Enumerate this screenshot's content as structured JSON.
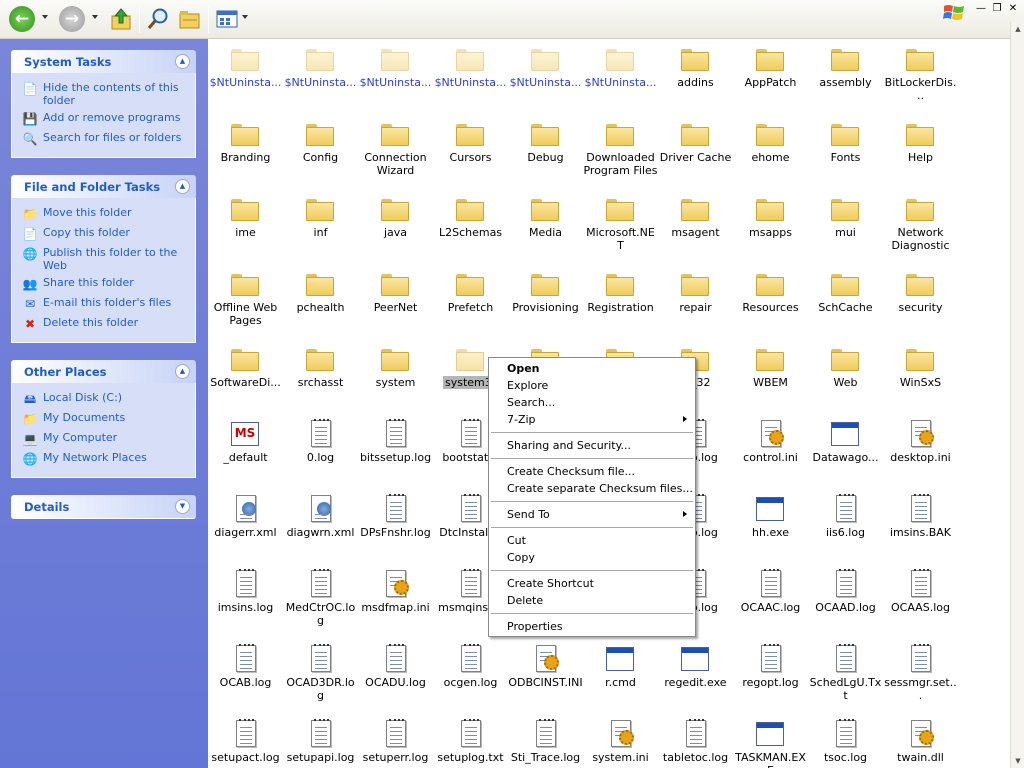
{
  "toolbar": {
    "back": "back-arrow-icon",
    "forward": "forward-arrow-icon",
    "up": "up-folder-icon",
    "search": "search-icon",
    "folders": "folders-icon",
    "views": "views-icon"
  },
  "left_pane": {
    "system_tasks": {
      "title": "System Tasks",
      "items": [
        {
          "label": "Hide the contents of this folder",
          "icon": "hide-icon"
        },
        {
          "label": "Add or remove programs",
          "icon": "add-remove-icon"
        },
        {
          "label": "Search for files or folders",
          "icon": "search-icon"
        }
      ]
    },
    "file_tasks": {
      "title": "File and Folder Tasks",
      "items": [
        {
          "label": "Move this folder",
          "icon": "move-icon"
        },
        {
          "label": "Copy this folder",
          "icon": "copy-icon"
        },
        {
          "label": "Publish this folder to the Web",
          "icon": "publish-icon"
        },
        {
          "label": "Share this folder",
          "icon": "share-icon"
        },
        {
          "label": "E-mail this folder's files",
          "icon": "email-icon"
        },
        {
          "label": "Delete this folder",
          "icon": "delete-icon"
        }
      ]
    },
    "other_places": {
      "title": "Other Places",
      "items": [
        {
          "label": "Local Disk (C:)",
          "icon": "drive-icon"
        },
        {
          "label": "My Documents",
          "icon": "my-documents-icon"
        },
        {
          "label": "My Computer",
          "icon": "my-computer-icon"
        },
        {
          "label": "My Network Places",
          "icon": "network-icon"
        }
      ]
    },
    "details": {
      "title": "Details"
    }
  },
  "files": [
    {
      "name": "$NtUninsta...",
      "type": "folder",
      "hidden": true
    },
    {
      "name": "$NtUninsta...",
      "type": "folder",
      "hidden": true
    },
    {
      "name": "$NtUninsta...",
      "type": "folder",
      "hidden": true
    },
    {
      "name": "$NtUninsta...",
      "type": "folder",
      "hidden": true
    },
    {
      "name": "$NtUninsta...",
      "type": "folder",
      "hidden": true
    },
    {
      "name": "$NtUninsta...",
      "type": "folder",
      "hidden": true
    },
    {
      "name": "addins",
      "type": "folder"
    },
    {
      "name": "AppPatch",
      "type": "folder"
    },
    {
      "name": "assembly",
      "type": "folder"
    },
    {
      "name": "BitLockerDis...",
      "type": "folder"
    },
    {
      "name": "Branding",
      "type": "folder"
    },
    {
      "name": "Config",
      "type": "folder"
    },
    {
      "name": "Connection Wizard",
      "type": "folder"
    },
    {
      "name": "Cursors",
      "type": "folder"
    },
    {
      "name": "Debug",
      "type": "folder"
    },
    {
      "name": "Downloaded Program Files",
      "type": "folder"
    },
    {
      "name": "Driver Cache",
      "type": "folder"
    },
    {
      "name": "ehome",
      "type": "folder"
    },
    {
      "name": "Fonts",
      "type": "folder"
    },
    {
      "name": "Help",
      "type": "folder"
    },
    {
      "name": "ime",
      "type": "folder"
    },
    {
      "name": "inf",
      "type": "folder"
    },
    {
      "name": "java",
      "type": "folder"
    },
    {
      "name": "L2Schemas",
      "type": "folder"
    },
    {
      "name": "Media",
      "type": "folder"
    },
    {
      "name": "Microsoft.NET",
      "type": "folder"
    },
    {
      "name": "msagent",
      "type": "folder"
    },
    {
      "name": "msapps",
      "type": "folder"
    },
    {
      "name": "mui",
      "type": "folder"
    },
    {
      "name": "Network Diagnostic",
      "type": "folder"
    },
    {
      "name": "Offline Web Pages",
      "type": "folder"
    },
    {
      "name": "pchealth",
      "type": "folder"
    },
    {
      "name": "PeerNet",
      "type": "folder"
    },
    {
      "name": "Prefetch",
      "type": "folder"
    },
    {
      "name": "Provisioning",
      "type": "folder"
    },
    {
      "name": "Registration",
      "type": "folder"
    },
    {
      "name": "repair",
      "type": "folder"
    },
    {
      "name": "Resources",
      "type": "folder"
    },
    {
      "name": "SchCache",
      "type": "folder"
    },
    {
      "name": "security",
      "type": "folder"
    },
    {
      "name": "SoftwareDi...",
      "type": "folder"
    },
    {
      "name": "srchasst",
      "type": "folder"
    },
    {
      "name": "system",
      "type": "folder"
    },
    {
      "name": "system3...",
      "type": "folder",
      "selected": true
    },
    {
      "name": "",
      "type": "folder",
      "covered": true
    },
    {
      "name": "",
      "type": "folder",
      "covered": true
    },
    {
      "name": "..._32",
      "type": "folder"
    },
    {
      "name": "WBEM",
      "type": "folder"
    },
    {
      "name": "Web",
      "type": "folder"
    },
    {
      "name": "WinSxS",
      "type": "folder"
    },
    {
      "name": "_default",
      "type": "msagent"
    },
    {
      "name": "0.log",
      "type": "doc"
    },
    {
      "name": "bitssetup.log",
      "type": "doc"
    },
    {
      "name": "bootstat...",
      "type": "doc"
    },
    {
      "name": "",
      "type": "doc",
      "covered": true
    },
    {
      "name": "",
      "type": "doc",
      "covered": true
    },
    {
      "name": "...up.log",
      "type": "doc"
    },
    {
      "name": "control.ini",
      "type": "ini"
    },
    {
      "name": "Datawago...",
      "type": "exe"
    },
    {
      "name": "desktop.ini",
      "type": "ini"
    },
    {
      "name": "diagerr.xml",
      "type": "xml"
    },
    {
      "name": "diagwrn.xml",
      "type": "xml"
    },
    {
      "name": "DPsFnshr.log",
      "type": "doc"
    },
    {
      "name": "DtcInstall...",
      "type": "doc"
    },
    {
      "name": "",
      "type": "doc",
      "covered": true
    },
    {
      "name": "",
      "type": "doc",
      "covered": true
    },
    {
      "name": "...up.log",
      "type": "doc"
    },
    {
      "name": "hh.exe",
      "type": "exe"
    },
    {
      "name": "iis6.log",
      "type": "doc"
    },
    {
      "name": "imsins.BAK",
      "type": "doc"
    },
    {
      "name": "imsins.log",
      "type": "doc"
    },
    {
      "name": "MedCtrOC.log",
      "type": "doc"
    },
    {
      "name": "msdfmap.ini",
      "type": "ini"
    },
    {
      "name": "msmqinst...",
      "type": "doc"
    },
    {
      "name": "",
      "type": "doc",
      "covered": true
    },
    {
      "name": "",
      "type": "doc",
      "covered": true
    },
    {
      "name": "...up.log",
      "type": "doc"
    },
    {
      "name": "OCAAC.log",
      "type": "doc"
    },
    {
      "name": "OCAAD.log",
      "type": "doc"
    },
    {
      "name": "OCAAS.log",
      "type": "doc"
    },
    {
      "name": "OCAB.log",
      "type": "doc"
    },
    {
      "name": "OCAD3DR.log",
      "type": "doc"
    },
    {
      "name": "OCADU.log",
      "type": "doc"
    },
    {
      "name": "ocgen.log",
      "type": "doc"
    },
    {
      "name": "ODBCINST.INI",
      "type": "ini"
    },
    {
      "name": "r.cmd",
      "type": "exe"
    },
    {
      "name": "regedit.exe",
      "type": "exe"
    },
    {
      "name": "regopt.log",
      "type": "doc"
    },
    {
      "name": "SchedLgU.Txt",
      "type": "doc"
    },
    {
      "name": "sessmgr.set...",
      "type": "doc"
    },
    {
      "name": "setupact.log",
      "type": "doc"
    },
    {
      "name": "setupapi.log",
      "type": "doc"
    },
    {
      "name": "setuperr.log",
      "type": "doc"
    },
    {
      "name": "setuplog.txt",
      "type": "doc"
    },
    {
      "name": "Sti_Trace.log",
      "type": "doc"
    },
    {
      "name": "system.ini",
      "type": "ini"
    },
    {
      "name": "tabletoc.log",
      "type": "doc"
    },
    {
      "name": "TASKMAN.EXE",
      "type": "exe"
    },
    {
      "name": "tsoc.log",
      "type": "doc"
    },
    {
      "name": "twain.dll",
      "type": "ini"
    }
  ],
  "context_menu": {
    "groups": [
      [
        {
          "label": "Open",
          "bold": true
        },
        {
          "label": "Explore"
        },
        {
          "label": "Search..."
        },
        {
          "label": "7-Zip",
          "submenu": true
        }
      ],
      [
        {
          "label": "Sharing and Security..."
        }
      ],
      [
        {
          "label": "Create Checksum file..."
        },
        {
          "label": "Create separate Checksum files..."
        }
      ],
      [
        {
          "label": "Send To",
          "submenu": true
        }
      ],
      [
        {
          "label": "Cut"
        },
        {
          "label": "Copy"
        }
      ],
      [
        {
          "label": "Create Shortcut"
        },
        {
          "label": "Delete"
        }
      ],
      [
        {
          "label": "Properties"
        }
      ]
    ]
  }
}
